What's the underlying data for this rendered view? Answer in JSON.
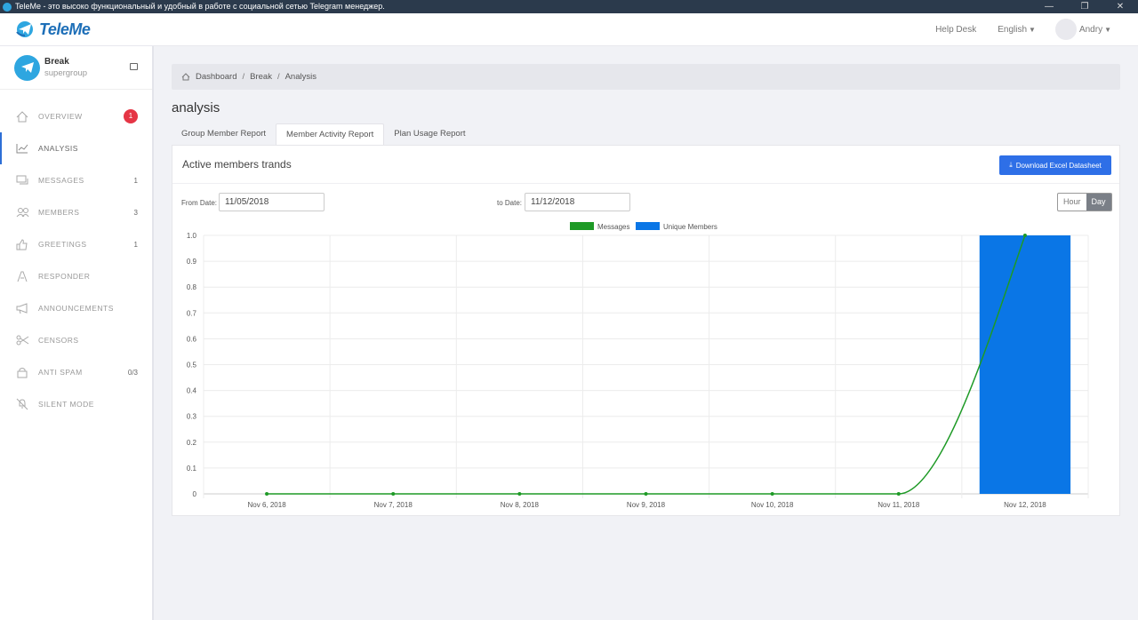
{
  "window": {
    "title": "TeleMe - это высоко функциональный и удобный в работе с социальной сетью Telegram менеджер.",
    "controls": [
      "—",
      "❐",
      "✕"
    ]
  },
  "header": {
    "brand": "TeleMe",
    "help": "Help Desk",
    "language": "English",
    "user": "Andry"
  },
  "group": {
    "name": "Break",
    "type": "supergroup"
  },
  "sidebar": {
    "items": [
      {
        "label": "OVERVIEW",
        "icon": "home-icon",
        "badge": "1"
      },
      {
        "label": "ANALYSIS",
        "icon": "chart-icon",
        "active": true
      },
      {
        "label": "MESSAGES",
        "icon": "messages-icon",
        "count": "1"
      },
      {
        "label": "MEMBERS",
        "icon": "members-icon",
        "count": "3"
      },
      {
        "label": "GREETINGS",
        "icon": "thumbs-up-icon",
        "count": "1"
      },
      {
        "label": "RESPONDER",
        "icon": "responder-icon"
      },
      {
        "label": "ANNOUNCEMENTS",
        "icon": "megaphone-icon"
      },
      {
        "label": "CENSORS",
        "icon": "scissors-icon"
      },
      {
        "label": "ANTI SPAM",
        "icon": "spam-icon",
        "count": "0/3"
      },
      {
        "label": "SILENT MODE",
        "icon": "mute-icon"
      }
    ]
  },
  "breadcrumb": [
    "Dashboard",
    "Break",
    "Analysis"
  ],
  "page": {
    "title": "analysis",
    "tabs": [
      "Group Member Report",
      "Member Activity Report",
      "Plan Usage Report"
    ],
    "active_tab": 1
  },
  "panel": {
    "title": "Active members trands",
    "download_label": "Download Excel Datasheet",
    "from_label": "From Date:",
    "from_value": "11/05/2018",
    "to_label": "to Date:",
    "to_value": "11/12/2018",
    "granularity": [
      "Hour",
      "Day"
    ],
    "granularity_selected": "Day"
  },
  "colors": {
    "messages": "#1e9a26",
    "unique_members": "#0a76e6",
    "accent": "#2e6fe7",
    "badge": "#e53545"
  },
  "chart_data": {
    "type": "bar",
    "categories": [
      "Nov 6, 2018",
      "Nov 7, 2018",
      "Nov 8, 2018",
      "Nov 9, 2018",
      "Nov 10, 2018",
      "Nov 11, 2018",
      "Nov 12, 2018"
    ],
    "series": [
      {
        "name": "Messages",
        "type": "line",
        "values": [
          0,
          0,
          0,
          0,
          0,
          0,
          1
        ]
      },
      {
        "name": "Unique Members",
        "type": "bar",
        "values": [
          0,
          0,
          0,
          0,
          0,
          0,
          1
        ]
      }
    ],
    "ylim": [
      0,
      1
    ],
    "yticks": [
      "1.0",
      "0.9",
      "0.8",
      "0.7",
      "0.6",
      "0.5",
      "0.4",
      "0.3",
      "0.2",
      "0.1",
      "0"
    ],
    "legend": "top-center",
    "grid": true
  }
}
